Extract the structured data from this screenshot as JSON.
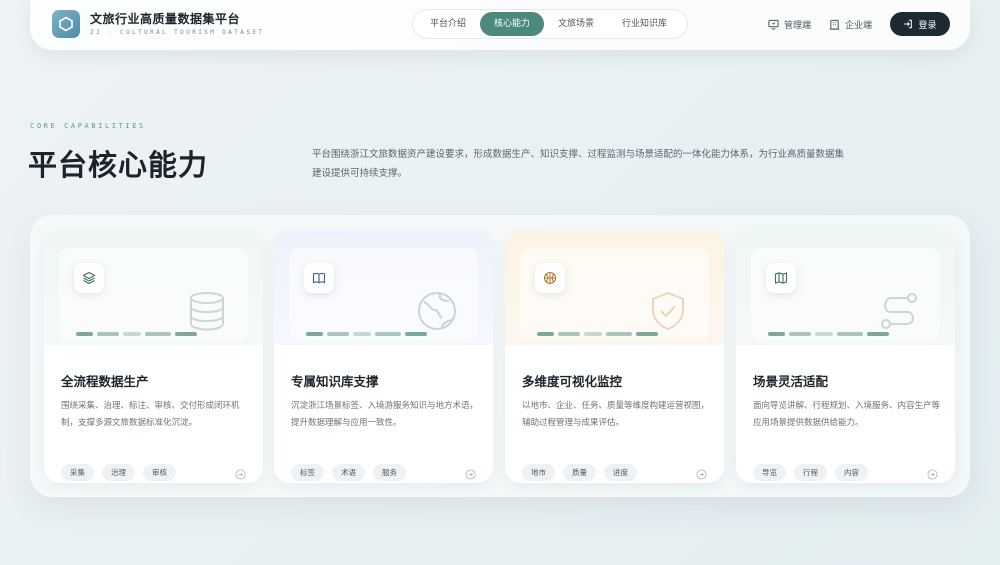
{
  "brand": {
    "title": "文旅行业高质量数据集平台",
    "subtitle": "ZJ · CULTURAL TOURISM DATASET"
  },
  "nav": {
    "items": [
      {
        "label": "平台介绍",
        "active": false
      },
      {
        "label": "核心能力",
        "active": true
      },
      {
        "label": "文旅场景",
        "active": false
      },
      {
        "label": "行业知识库",
        "active": false
      }
    ]
  },
  "actions": {
    "admin": "管理端",
    "enterprise": "企业端",
    "login": "登录"
  },
  "section": {
    "eyebrow": "CORE CAPABILITIES",
    "title": "平台核心能力",
    "description": "平台围绕浙江文旅数据资产建设要求，形成数据生产、知识支撑、过程监测与场景适配的一体化能力体系，为行业高质量数据集建设提供可持续支撑。"
  },
  "cards": [
    {
      "title": "全流程数据生产",
      "description": "围绕采集、治理、标注、审核、交付形成闭环机制，支撑多源文旅数据标准化沉淀。",
      "tags": [
        "采集",
        "治理",
        "审核"
      ],
      "icon": "layers-icon",
      "big_icon": "database-icon"
    },
    {
      "title": "专属知识库支撑",
      "description": "沉淀浙江场景标签、入境游服务知识与地方术语，提升数据理解与应用一致性。",
      "tags": [
        "标签",
        "术语",
        "服务"
      ],
      "icon": "book-icon",
      "big_icon": "globe-icon"
    },
    {
      "title": "多维度可视化监控",
      "description": "以地市、企业、任务、质量等维度构建运营视图，辅助过程管理与成果评估。",
      "tags": [
        "地市",
        "质量",
        "进度"
      ],
      "icon": "basketball-icon",
      "big_icon": "shield-check-icon"
    },
    {
      "title": "场景灵活适配",
      "description": "面向导览讲解、行程规划、入境服务、内容生产等应用场景提供数据供给能力。",
      "tags": [
        "导览",
        "行程",
        "内容"
      ],
      "icon": "map-icon",
      "big_icon": "route-icon"
    }
  ],
  "colors": {
    "accent": "#4d8a7e",
    "login_bg": "#1e2a33"
  }
}
